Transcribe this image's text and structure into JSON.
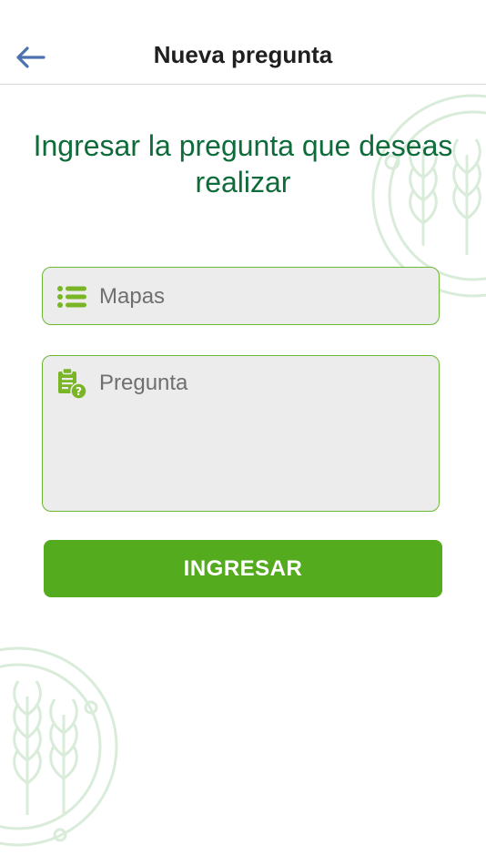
{
  "header": {
    "title": "Nueva pregunta",
    "back_icon": "arrow-left-icon",
    "back_color": "#4a72b0"
  },
  "prompt": {
    "text": "Ingresar la pregunta que deseas realizar"
  },
  "form": {
    "mapas": {
      "placeholder": "Mapas",
      "value": "",
      "icon": "list-icon"
    },
    "pregunta": {
      "placeholder": "Pregunta",
      "value": "",
      "icon": "clipboard-question-icon"
    },
    "submit_label": "INGRESAR"
  },
  "colors": {
    "primary_green": "#54ab1e",
    "title_green": "#0e6b3a",
    "field_border": "#6bb832",
    "field_background": "#ebeceb",
    "icon_green": "#7ab526",
    "decoration_green": "#d8ecd8"
  }
}
